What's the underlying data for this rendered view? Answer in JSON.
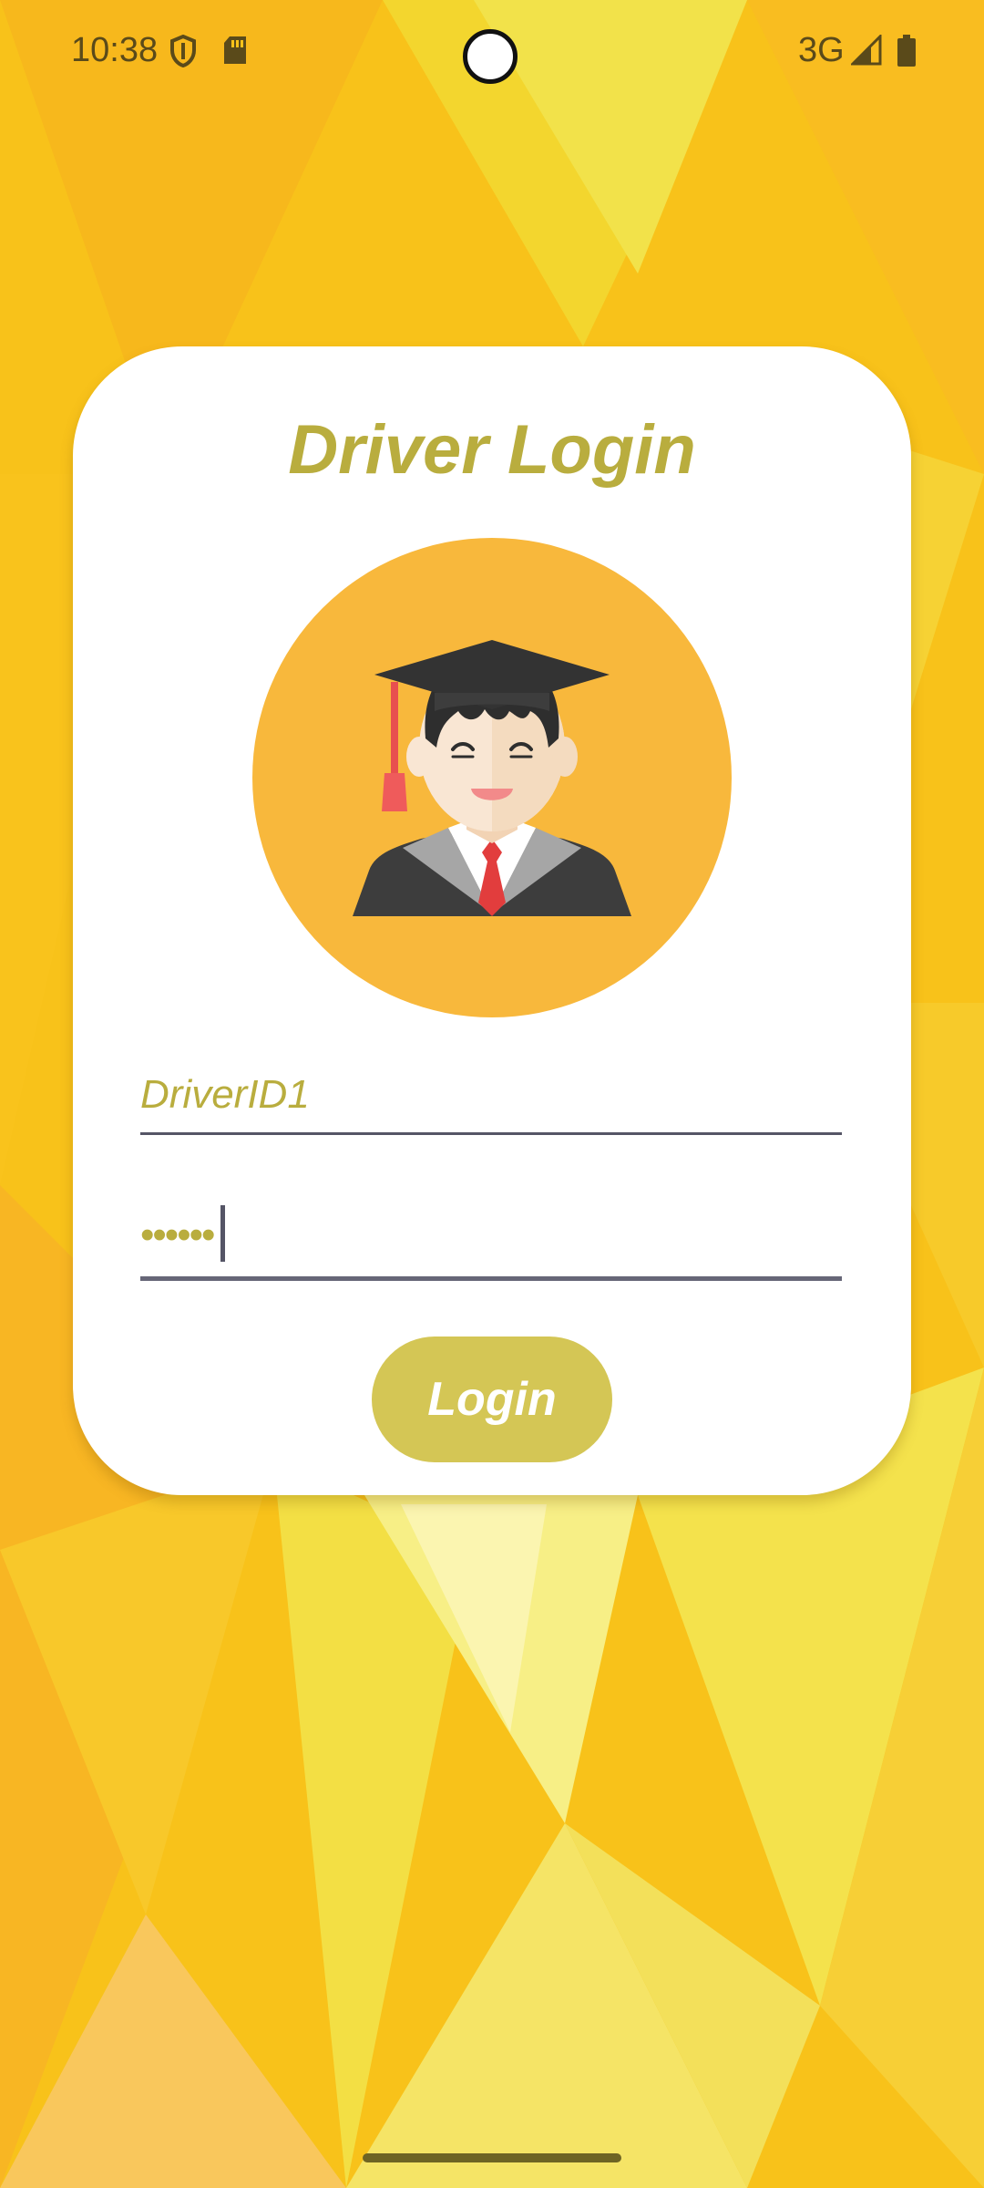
{
  "status_bar": {
    "time": "10:38",
    "network": "3G",
    "icons": [
      "shield-icon",
      "sd-card-icon",
      "signal-icon",
      "battery-icon"
    ]
  },
  "login_card": {
    "title": "Driver Login",
    "avatar_icon": "graduate-avatar-icon",
    "username_value": "DriverID1",
    "password_masked": "••••••",
    "login_label": "Login"
  },
  "colors": {
    "background": "#f8c21a",
    "accent_text": "#b9ad3e",
    "button": "#d4c655",
    "avatar_circle": "#f8b83c"
  }
}
